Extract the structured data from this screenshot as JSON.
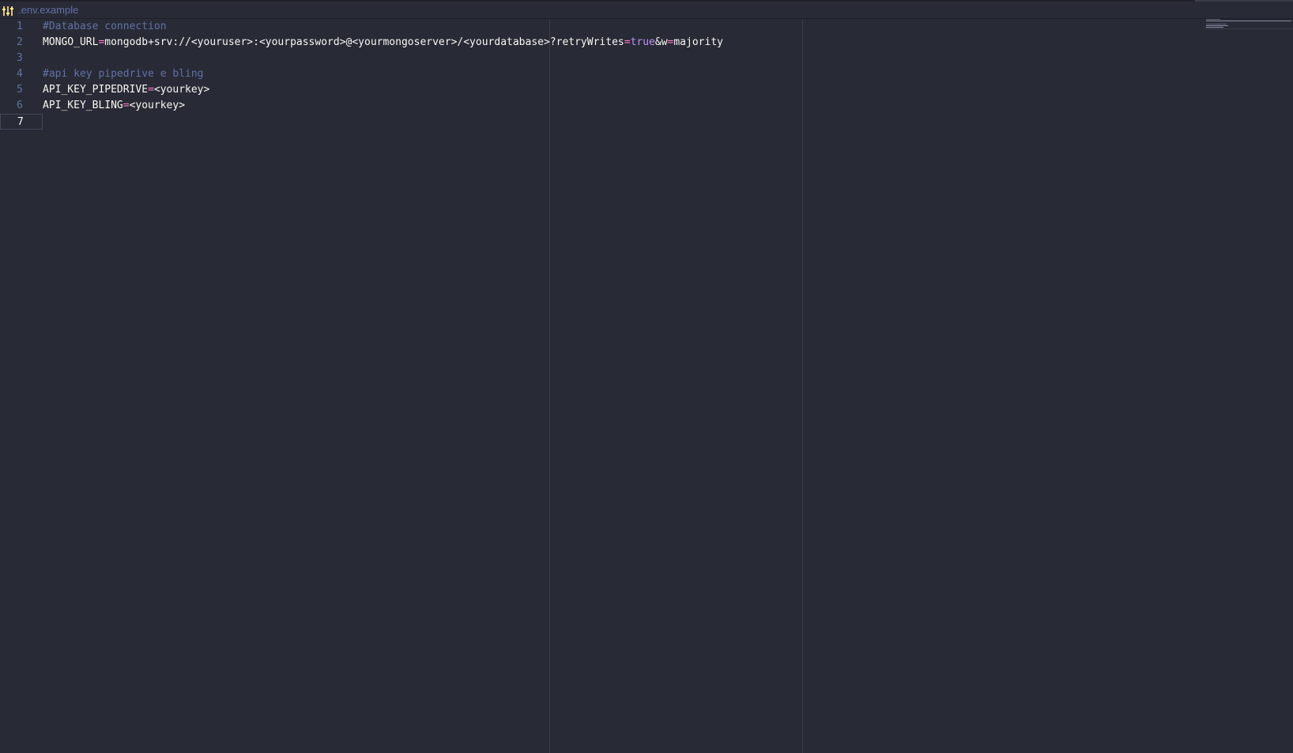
{
  "breadcrumb": {
    "file_name": ".env.example",
    "icon": "settings-file-icon"
  },
  "editor": {
    "current_line": 7,
    "lines": [
      {
        "number": "1",
        "comment": "#Database connection"
      },
      {
        "number": "2",
        "key": "MONGO_URL",
        "eq": "=",
        "value_a": "mongodb+srv://<youruser>:<yourpassword>@<yourmongoserver>/<yourdatabase>?retryWrites",
        "eq2": "=",
        "bool": "true",
        "value_b": "&w",
        "eq3": "=",
        "value_c": "majority"
      },
      {
        "number": "3"
      },
      {
        "number": "4",
        "comment": "#api key pipedrive e bling"
      },
      {
        "number": "5",
        "key": "API_KEY_PIPEDRIVE",
        "eq": "=",
        "value": "<yourkey>"
      },
      {
        "number": "6",
        "key": "API_KEY_BLING",
        "eq": "=",
        "value": "<yourkey>"
      },
      {
        "number": "7"
      }
    ]
  },
  "colors": {
    "background": "#282a36",
    "comment": "#6272a4",
    "operator": "#ff79c6",
    "boolean": "#bd93f9",
    "foreground": "#f8f8f2"
  }
}
